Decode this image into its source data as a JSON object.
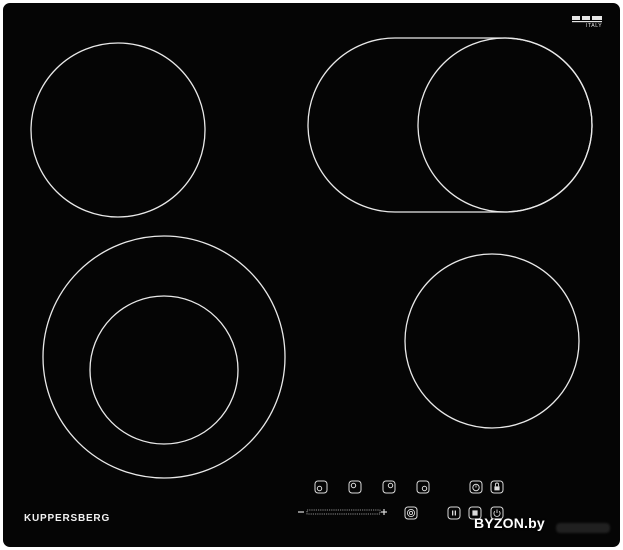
{
  "product": {
    "brand": "KUPPERSBERG",
    "origin_mark": "ITALY",
    "watermark": "BYZON.by",
    "surface_color": "#050505",
    "ring_color": "#e9e9e9"
  },
  "icons": {
    "controls": [
      "zone-front-left-icon",
      "zone-rear-left-icon",
      "zone-rear-right-icon",
      "zone-front-right-icon",
      "timer-icon",
      "lock-icon",
      "dual-zone-icon",
      "pause-icon",
      "power-icon"
    ],
    "slider": [
      "minus-icon",
      "slider-track",
      "plus-icon"
    ]
  }
}
